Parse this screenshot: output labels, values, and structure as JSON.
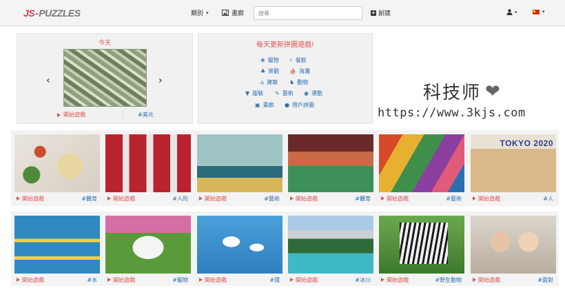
{
  "navbar": {
    "logo_js": "JS",
    "logo_dash": "-",
    "logo_puzzles": "PUZZLES",
    "category_label": "類別",
    "gallery_label": "畫廊",
    "search_placeholder": "搜尋",
    "create_label": "創建"
  },
  "today": {
    "title": "今天",
    "play_label": "開始遊戲",
    "tag": "#美元"
  },
  "daily": {
    "title": "每天更新拼圖遊戲!",
    "categories": [
      {
        "label": "寵物",
        "icon": "paw-icon"
      },
      {
        "label": "餐飲",
        "icon": "utensils-icon"
      },
      {
        "label": "景觀",
        "icon": "tree-icon"
      },
      {
        "label": "海灘",
        "icon": "ship-icon"
      },
      {
        "label": "建築",
        "icon": "building-icon"
      },
      {
        "label": "動物",
        "icon": "horse-icon"
      },
      {
        "label": "服裝",
        "icon": "tshirt-icon"
      },
      {
        "label": "藝術",
        "icon": "brush-icon"
      },
      {
        "label": "運動",
        "icon": "ball-icon"
      },
      {
        "label": "畫廊",
        "icon": "image-icon"
      },
      {
        "label": "用戶拼圖",
        "icon": "user-icon"
      }
    ]
  },
  "watermark": {
    "text": "科技师",
    "url": "https://www.3kjs.com"
  },
  "puzzles_row1": [
    {
      "play": "開始遊戲",
      "tag": "#體育"
    },
    {
      "play": "開始遊戲",
      "tag": "#人的"
    },
    {
      "play": "開始遊戲",
      "tag": "#藝術"
    },
    {
      "play": "開始遊戲",
      "tag": "#體育"
    },
    {
      "play": "開始遊戲",
      "tag": "#藝術"
    },
    {
      "play": "開始遊戲",
      "tag": "#人"
    }
  ],
  "puzzles_row2": [
    {
      "play": "開始遊戲",
      "tag": "#水"
    },
    {
      "play": "開始遊戲",
      "tag": "#寵物"
    },
    {
      "play": "開始遊戲",
      "tag": "#環"
    },
    {
      "play": "開始遊戲",
      "tag": "#冰川"
    },
    {
      "play": "開始遊戲",
      "tag": "#野生動物"
    },
    {
      "play": "開始遊戲",
      "tag": "#面對"
    }
  ],
  "thumb_banner_text": "TOKYO 2020"
}
